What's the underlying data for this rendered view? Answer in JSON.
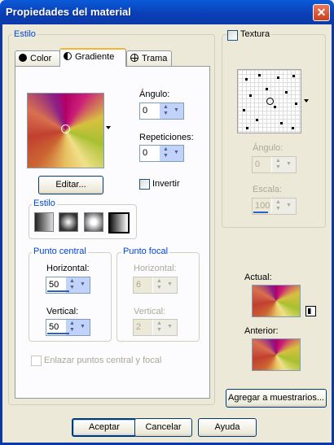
{
  "window": {
    "title": "Propiedades del material",
    "close_symbol": "✕"
  },
  "estilo_group": {
    "legend": "Estilo"
  },
  "tabs": [
    {
      "label": "Color",
      "icon": "filled-circle-icon"
    },
    {
      "label": "Gradiente",
      "icon": "half-circle-icon"
    },
    {
      "label": "Trama",
      "icon": "crosshair-globe-icon"
    }
  ],
  "angle": {
    "label": "Ángulo:",
    "value": "0"
  },
  "repeats": {
    "label": "Repeticiones:",
    "value": "0"
  },
  "edit_button": {
    "label": "Editar..."
  },
  "invert": {
    "label": "Invertir",
    "checked": false
  },
  "style_box": {
    "legend": "Estilo"
  },
  "center_point": {
    "legend": "Punto central",
    "h_label": "Horizontal:",
    "h_value": "50",
    "v_label": "Vertical:",
    "v_value": "50"
  },
  "focal_point": {
    "legend": "Punto focal",
    "h_label": "Horizontal:",
    "h_value": "6",
    "v_label": "Vertical:",
    "v_value": "2"
  },
  "link_points": {
    "label": "Enlazar puntos central y focal",
    "checked": false
  },
  "texture": {
    "label": "Textura",
    "checked": false,
    "angle_label": "Ángulo:",
    "angle_value": "0",
    "scale_label": "Escala:",
    "scale_value": "100"
  },
  "current": {
    "label": "Actual:"
  },
  "previous": {
    "label": "Anterior:"
  },
  "add_swatch_button": {
    "label": "Agregar a muestrarios..."
  },
  "footer": {
    "accept": "Aceptar",
    "cancel": "Cancelar",
    "help": "Ayuda"
  },
  "colors": {
    "title_bar": "#0a3fb8",
    "legend": "#0046d5",
    "dialog_bg": "#ece9d8",
    "active_tab_accent": "#f8b331"
  }
}
